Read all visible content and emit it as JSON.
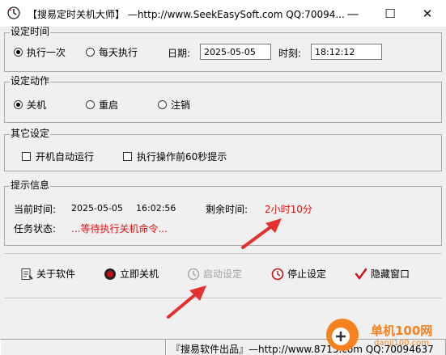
{
  "window": {
    "title": "【搜易定时关机大师】 —http://www.SeekEasySoft.com QQ:70094...",
    "minimize": "—",
    "maximize": "☐",
    "close": "✕"
  },
  "time_settings": {
    "group_title": "设定时间",
    "radio_once": "执行一次",
    "radio_daily": "每天执行",
    "date_label": "日期:",
    "date_value": "2025-05-05",
    "time_label": "时刻:",
    "time_value": "18:12:12"
  },
  "action_settings": {
    "group_title": "设定动作",
    "shutdown": "关机",
    "restart": "重启",
    "logoff": "注销"
  },
  "other_settings": {
    "group_title": "其它设定",
    "autostart": "开机自动运行",
    "warn60": "执行操作前60秒提示"
  },
  "info": {
    "group_title": "提示信息",
    "current_time_label": "当前时间:",
    "current_date": "2025-05-05",
    "current_time": "16:02:56",
    "remaining_label": "剩余时间:",
    "remaining_value": "2小时10分",
    "status_label": "任务状态:",
    "status_value": "...等待执行关机命令..."
  },
  "toolbar": {
    "about": "关于软件",
    "shutdown_now": "立即关机",
    "start_setting": "启动设定",
    "stop_setting": "停止设定",
    "hide_window": "隐藏窗口"
  },
  "statusbar": {
    "text": "『搜易软件出品』—http://www.8715.com  QQ:70094637"
  },
  "watermark": {
    "site": "单机100网",
    "domain": "danji100.com"
  },
  "colors": {
    "remaining_text": "#e01010",
    "status_text": "#e01010",
    "annotation_arrow": "#e53030",
    "watermark_orange": "#f5821f"
  }
}
